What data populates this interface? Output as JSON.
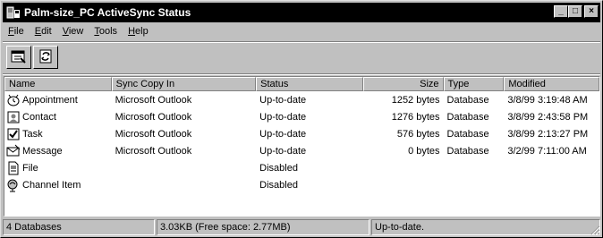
{
  "window": {
    "title": "Palm-size_PC ActiveSync Status",
    "buttons": {
      "minimize": "_",
      "maximize": "□",
      "close": "×"
    }
  },
  "menu": [
    {
      "label": "File",
      "mnemonic": "F",
      "rest": "ile"
    },
    {
      "label": "Edit",
      "mnemonic": "E",
      "rest": "dit"
    },
    {
      "label": "View",
      "mnemonic": "V",
      "rest": "iew"
    },
    {
      "label": "Tools",
      "mnemonic": "T",
      "rest": "ools"
    },
    {
      "label": "Help",
      "mnemonic": "H",
      "rest": "elp"
    }
  ],
  "toolbar": {
    "buttons": [
      {
        "name": "properties-button",
        "icon": "properties-icon"
      },
      {
        "name": "sync-now-button",
        "icon": "sync-icon"
      }
    ]
  },
  "columns": [
    "Name",
    "Sync Copy In",
    "Status",
    "Size",
    "Type",
    "Modified"
  ],
  "rows": [
    {
      "icon": "appointment-icon",
      "name": "Appointment",
      "sync": "Microsoft Outlook",
      "status": "Up-to-date",
      "size": "1252 bytes",
      "type": "Database",
      "modified": "3/8/99 3:19:48 AM"
    },
    {
      "icon": "contact-icon",
      "name": "Contact",
      "sync": "Microsoft Outlook",
      "status": "Up-to-date",
      "size": "1276 bytes",
      "type": "Database",
      "modified": "3/8/99 2:43:58 PM"
    },
    {
      "icon": "task-icon",
      "name": "Task",
      "sync": "Microsoft Outlook",
      "status": "Up-to-date",
      "size": "576 bytes",
      "type": "Database",
      "modified": "3/8/99 2:13:27 PM"
    },
    {
      "icon": "message-icon",
      "name": "Message",
      "sync": "Microsoft Outlook",
      "status": "Up-to-date",
      "size": "0 bytes",
      "type": "Database",
      "modified": "3/2/99 7:11:00 AM"
    },
    {
      "icon": "file-icon",
      "name": "File",
      "sync": "",
      "status": "Disabled",
      "size": "",
      "type": "",
      "modified": ""
    },
    {
      "icon": "channel-item-icon",
      "name": "Channel Item",
      "sync": "",
      "status": "Disabled",
      "size": "",
      "type": "",
      "modified": ""
    }
  ],
  "statusbar": {
    "count": "4 Databases",
    "space": "3.03KB (Free space: 2.77MB)",
    "state": "Up-to-date."
  }
}
